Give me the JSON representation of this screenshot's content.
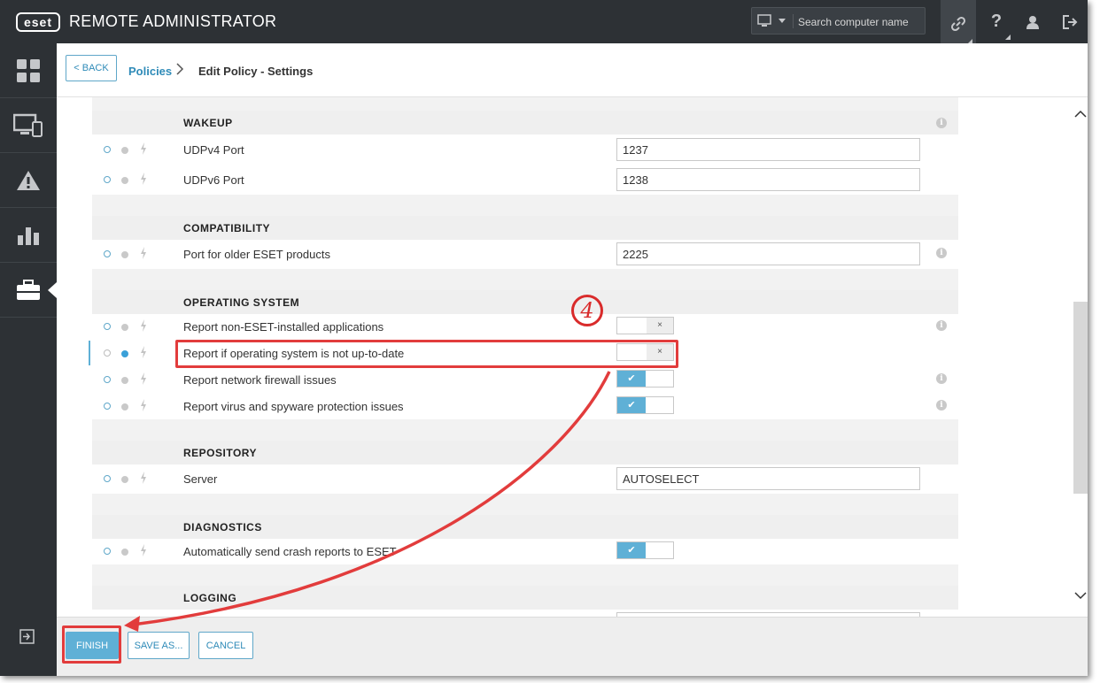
{
  "app": {
    "logo_text": "eset",
    "title": "REMOTE ADMINISTRATOR",
    "search_placeholder": "Search computer name",
    "top_icons": [
      "link-icon",
      "help-icon",
      "user-icon",
      "logout-icon"
    ]
  },
  "sidebar": {
    "items": [
      "dashboard-icon",
      "computers-icon",
      "threats-icon",
      "reports-icon",
      "admin-icon"
    ],
    "active": "admin-icon",
    "bottom": "collapse-icon"
  },
  "header": {
    "back_label": "< BACK",
    "crumb_link": "Policies",
    "crumb_current": "Edit Policy - Settings"
  },
  "sections": {
    "wakeup": {
      "title": "WAKEUP",
      "rows": [
        {
          "label": "UDPv4 Port",
          "value": "1237"
        },
        {
          "label": "UDPv6 Port",
          "value": "1238"
        }
      ]
    },
    "compatibility": {
      "title": "COMPATIBILITY",
      "rows": [
        {
          "label": "Port for older ESET products",
          "value": "2225"
        }
      ]
    },
    "operating_system": {
      "title": "OPERATING SYSTEM",
      "rows": [
        {
          "label": "Report non-ESET-installed applications",
          "state": "off",
          "glyph": "×"
        },
        {
          "label": "Report if operating system is not up-to-date",
          "state": "off",
          "glyph": "×"
        },
        {
          "label": "Report network firewall issues",
          "state": "on",
          "glyph": "✔"
        },
        {
          "label": "Report virus and spyware protection issues",
          "state": "on",
          "glyph": "✔"
        }
      ]
    },
    "repository": {
      "title": "REPOSITORY",
      "rows": [
        {
          "label": "Server",
          "value": "AUTOSELECT"
        }
      ]
    },
    "diagnostics": {
      "title": "DIAGNOSTICS",
      "rows": [
        {
          "label": "Automatically send crash reports to ESET",
          "state": "on",
          "glyph": "✔"
        }
      ]
    },
    "logging": {
      "title": "LOGGING"
    }
  },
  "footer": {
    "finish_label": "FINISH",
    "save_as_label": "SAVE AS...",
    "cancel_label": "CANCEL"
  },
  "annotation": {
    "step_number": "4",
    "color": "#e23c3c"
  },
  "colors": {
    "topbar": "#2d3135",
    "accent": "#5fb0d6",
    "link": "#2f8bb8"
  }
}
